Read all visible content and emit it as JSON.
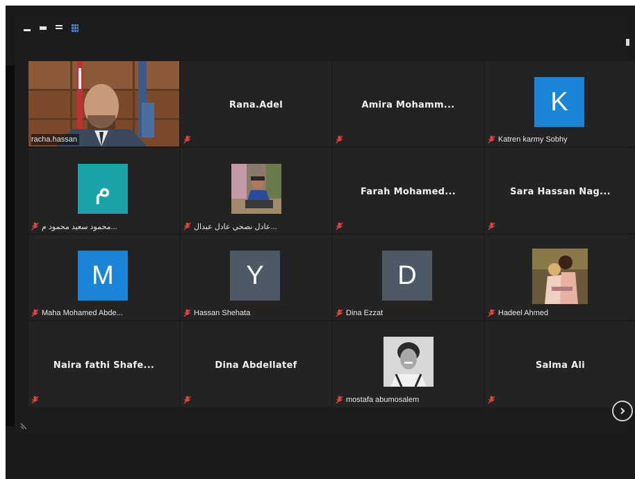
{
  "toolbar": {
    "icons": [
      "minimize-icon",
      "window-icon",
      "list-view-icon",
      "gallery-view-icon"
    ]
  },
  "participants": [
    {
      "name": "racha.hassan",
      "label": "racha.hassan",
      "type": "video",
      "active": true,
      "muted": false
    },
    {
      "name": "Rana.Adel",
      "label": "",
      "type": "name",
      "muted": true
    },
    {
      "name": "Amira  Mohamm...",
      "label": "",
      "type": "name",
      "muted": true
    },
    {
      "name": "Katren karmy Sobhy",
      "label": "Katren karmy Sobhy",
      "type": "letter",
      "letter": "K",
      "color": "#1a85d6",
      "muted": true
    },
    {
      "name": "محمود سعيد محمود م...",
      "label": "محمود سعيد محمود م...",
      "type": "letter",
      "letter": "م",
      "color": "#1aa3a8",
      "muted": true
    },
    {
      "name": "عادل نصحي عادل عبدال...",
      "label": "عادل نصحي عادل عبدال...",
      "type": "photo",
      "muted": true
    },
    {
      "name": "Farah  Mohamed...",
      "label": "",
      "type": "name",
      "muted": true
    },
    {
      "name": "Sara  Hassan  Nag...",
      "label": "",
      "type": "name",
      "muted": true
    },
    {
      "name": "Maha Mohamed Abde...",
      "label": "Maha Mohamed Abde...",
      "type": "letter",
      "letter": "M",
      "color": "#1a85d6",
      "muted": true
    },
    {
      "name": "Hassan Shehata",
      "label": "Hassan Shehata",
      "type": "letter",
      "letter": "Y",
      "color": "#4d5a66",
      "muted": true
    },
    {
      "name": "Dina Ezzat",
      "label": "Dina Ezzat",
      "type": "letter",
      "letter": "D",
      "color": "#4d5a66",
      "muted": true
    },
    {
      "name": "Hadeel Ahmed",
      "label": "Hadeel Ahmed",
      "type": "photo",
      "muted": true
    },
    {
      "name": "Naira  fathi  Shafe...",
      "label": "",
      "type": "name",
      "muted": true
    },
    {
      "name": "Dina  Abdellatef",
      "label": "",
      "type": "name",
      "muted": true
    },
    {
      "name": "mostafa abumosalem",
      "label": "mostafa abumosalem",
      "type": "photo",
      "muted": true
    },
    {
      "name": "Salma  Ali",
      "label": "",
      "type": "name",
      "muted": true
    }
  ],
  "navigation": {
    "next_icon": "chevron-right-icon"
  },
  "colors": {
    "background": "#1c1c1c",
    "tile": "#232323",
    "muted_mic": "#e0443e",
    "active_border": "#a8d86a"
  }
}
